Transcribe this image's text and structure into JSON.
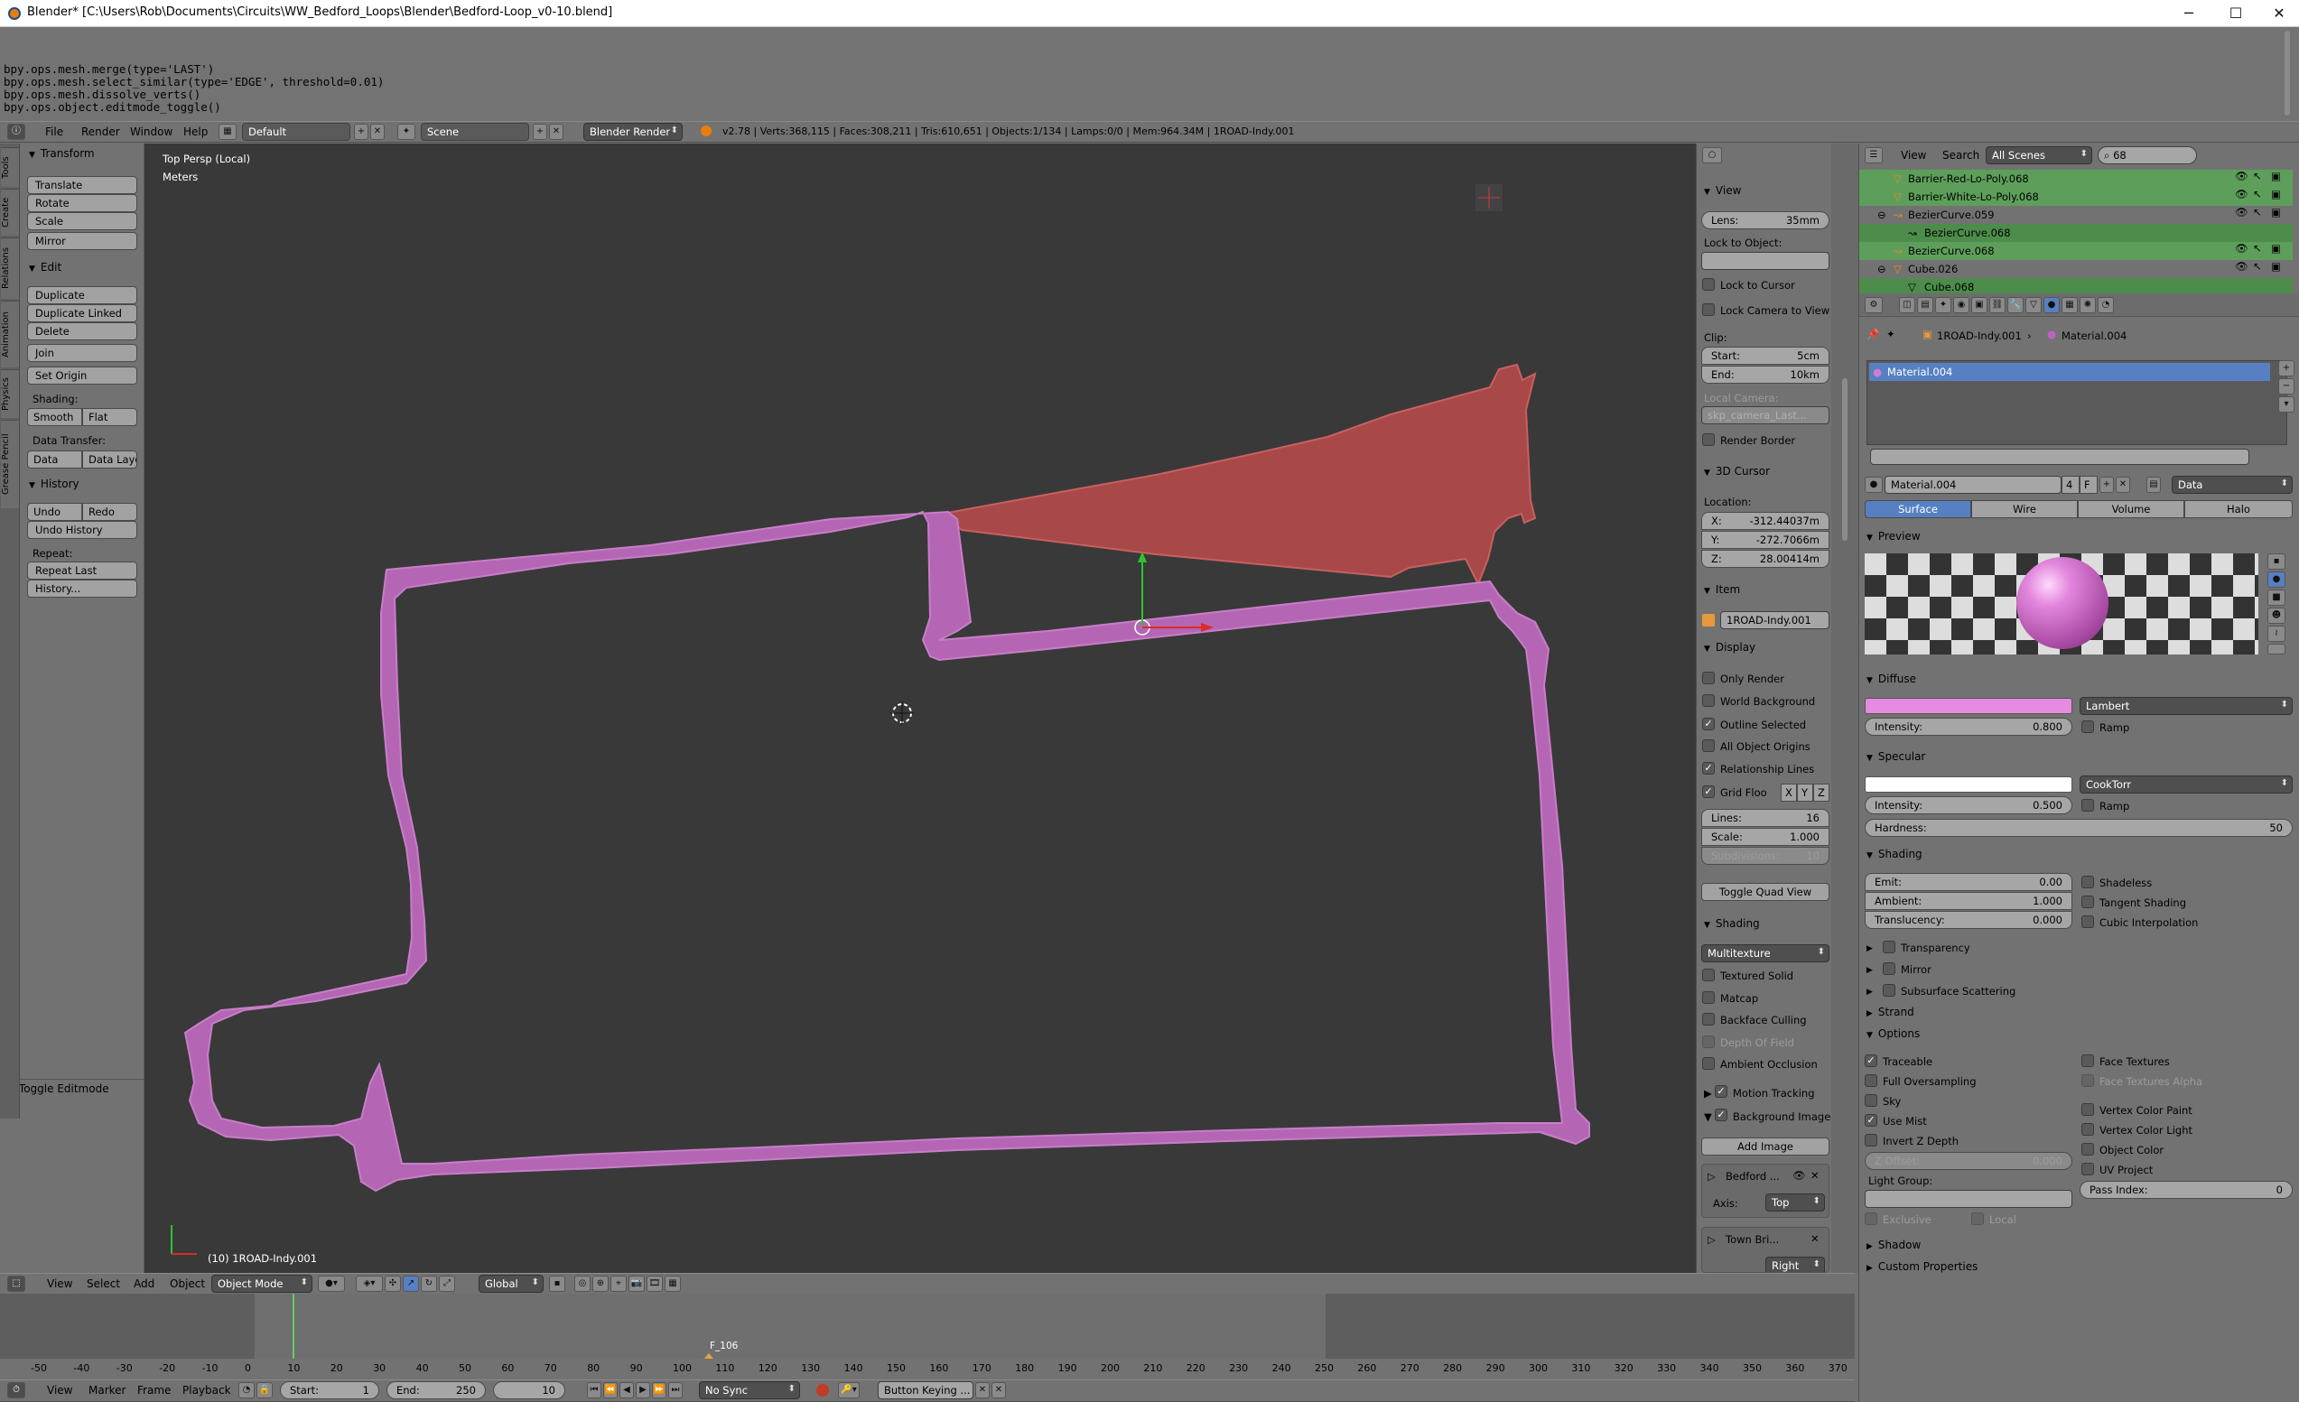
{
  "window": {
    "title": "Blender* [C:\\Users\\Rob\\Documents\\Circuits\\WW_Bedford_Loops\\Blender\\Bedford-Loop_v0-10.blend]",
    "minimize": "─",
    "maximize": "☐",
    "close": "✕"
  },
  "console": {
    "lines": "bpy.ops.mesh.merge(type='LAST')\nbpy.ops.mesh.select_similar(type='EDGE', threshold=0.01)\nbpy.ops.mesh.dissolve_verts()\nbpy.ops.object.editmode_toggle()"
  },
  "info_header": {
    "menus": [
      "File",
      "Render",
      "Window",
      "Help"
    ],
    "layout": "Default",
    "scene": "Scene",
    "engine": "Blender Render",
    "stats": "v2.78 | Verts:368,115 | Faces:308,211 | Tris:610,651 | Objects:1/134 | Lamps:0/0 | Mem:964.34M | 1ROAD-Indy.001"
  },
  "toolshelf": {
    "tabs": [
      "Tools",
      "Create",
      "Relations",
      "Animation",
      "Physics",
      "Grease Pencil"
    ],
    "transform": {
      "title": "Transform",
      "buttons": [
        "Translate",
        "Rotate",
        "Scale",
        "Mirror"
      ]
    },
    "edit": {
      "title": "Edit",
      "buttons": [
        "Duplicate",
        "Duplicate Linked",
        "Delete",
        "Join"
      ],
      "set_origin": "Set Origin",
      "shading_label": "Shading:",
      "smooth": "Smooth",
      "flat": "Flat",
      "data_transfer_label": "Data Transfer:",
      "data": "Data",
      "data_layo": "Data Layo"
    },
    "history": {
      "title": "History",
      "undo": "Undo",
      "redo": "Redo",
      "undo_history": "Undo History",
      "repeat_label": "Repeat:",
      "repeat_last": "Repeat Last",
      "history_btn": "History..."
    },
    "operator": "Toggle Editmode"
  },
  "viewport": {
    "view_name": "Top Persp (Local)",
    "units": "Meters",
    "object_label": "(10) 1ROAD-Indy.001"
  },
  "npanel": {
    "view": {
      "title": "View",
      "lens_label": "Lens:",
      "lens": "35mm",
      "lock_to_object": "Lock to Object:",
      "lock_to_cursor": "Lock to Cursor",
      "lock_camera": "Lock Camera to View",
      "clip": "Clip:",
      "start_label": "Start:",
      "start": "5cm",
      "end_label": "End:",
      "end": "10km",
      "local_camera": "Local Camera:",
      "local_camera_value": "skp_camera_Last...",
      "render_border": "Render Border"
    },
    "cursor": {
      "title": "3D Cursor",
      "location": "Location:",
      "x_label": "X:",
      "x": "-312.44037m",
      "y_label": "Y:",
      "y": "-272.7066m",
      "z_label": "Z:",
      "z": "28.00414m"
    },
    "item": {
      "title": "Item",
      "name": "1ROAD-Indy.001"
    },
    "display": {
      "title": "Display",
      "only_render": "Only Render",
      "world_background": "World Background",
      "outline_selected": "Outline Selected",
      "all_object_origins": "All Object Origins",
      "relationship_lines": "Relationship Lines",
      "grid_floor": "Grid Floo",
      "x": "X",
      "y": "Y",
      "z": "Z",
      "lines_label": "Lines:",
      "lines": "16",
      "scale_label": "Scale:",
      "scale": "1.000",
      "subdivisions_label": "Subdivisions:",
      "subdivisions": "10",
      "toggle_quad": "Toggle Quad View"
    },
    "shading": {
      "title": "Shading",
      "mode": "Multitexture",
      "textured_solid": "Textured Solid",
      "matcap": "Matcap",
      "backface_culling": "Backface Culling",
      "depth_of_field": "Depth Of Field",
      "ambient_occlusion": "Ambient Occlusion"
    },
    "motion_tracking": "Motion Tracking",
    "background_images": "Background Images",
    "add_image": "Add Image",
    "bg1": {
      "name": "Bedford ...",
      "axis_label": "Axis:",
      "axis": "Top"
    },
    "bg2": {
      "name": "Town Bri...",
      "axis": "Right"
    }
  },
  "outliner": {
    "view": "View",
    "search": "Search",
    "scenes": "All Scenes",
    "filter": "68",
    "rows": [
      "Barrier-Red-Lo-Poly.068",
      "Barrier-White-Lo-Poly.068",
      "BezierCurve.059",
      "BezierCurve.068",
      "BezierCurve.068",
      "Cube.026",
      "Cube.068"
    ]
  },
  "properties": {
    "breadcrumb_obj": "1ROAD-Indy.001",
    "breadcrumb_mat": "Material.004",
    "slot": "Material.004",
    "mat_name": "Material.004",
    "users": "4",
    "f": "F",
    "data_link": "Data",
    "tabs": [
      "Surface",
      "Wire",
      "Volume",
      "Halo"
    ],
    "preview": "Preview",
    "diffuse": {
      "title": "Diffuse",
      "shader": "Lambert",
      "intensity_label": "Intensity:",
      "intensity": "0.800",
      "ramp": "Ramp",
      "color": "#e58be0"
    },
    "specular": {
      "title": "Specular",
      "shader": "CookTorr",
      "intensity_label": "Intensity:",
      "intensity": "0.500",
      "ramp": "Ramp",
      "hardness_label": "Hardness:",
      "hardness": "50"
    },
    "shading": {
      "title": "Shading",
      "emit_label": "Emit:",
      "emit": "0.00",
      "ambient_label": "Ambient:",
      "ambient": "1.000",
      "translucency_label": "Translucency:",
      "translucency": "0.000",
      "shadeless": "Shadeless",
      "tangent": "Tangent Shading",
      "cubic": "Cubic Interpolation"
    },
    "transparency": "Transparency",
    "mirror": "Mirror",
    "sss": "Subsurface Scattering",
    "strand": "Strand",
    "options": {
      "title": "Options",
      "traceable": "Traceable",
      "full_oversampling": "Full Oversampling",
      "sky": "Sky",
      "use_mist": "Use Mist",
      "invert_z": "Invert Z Depth",
      "z_offset_label": "Z Offset:",
      "z_offset": "0.000",
      "light_group": "Light Group:",
      "exclusive": "Exclusive",
      "local": "Local",
      "face_textures": "Face Textures",
      "face_textures_alpha": "Face Textures Alpha",
      "vertex_color_paint": "Vertex Color Paint",
      "vertex_color_light": "Vertex Color Light",
      "object_color": "Object Color",
      "uv_project": "UV Project",
      "pass_index_label": "Pass Index:",
      "pass_index": "0"
    },
    "shadow": "Shadow",
    "custom_props": "Custom Properties"
  },
  "view3d_header": {
    "menus": [
      "View",
      "Select",
      "Add",
      "Object"
    ],
    "mode": "Object Mode",
    "orientation": "Global"
  },
  "timeline": {
    "ticks": [
      "-50",
      "-40",
      "-30",
      "-20",
      "-10",
      "0",
      "10",
      "20",
      "30",
      "40",
      "50",
      "60",
      "70",
      "80",
      "90",
      "100",
      "110",
      "120",
      "130",
      "140",
      "150",
      "160",
      "170",
      "180",
      "190",
      "200",
      "210",
      "220",
      "230",
      "240",
      "250",
      "260",
      "270",
      "280",
      "290",
      "300",
      "310",
      "320",
      "330",
      "340",
      "350",
      "360",
      "370"
    ],
    "marker": "F_106",
    "current_frame": 10
  },
  "timeline_header": {
    "menus": [
      "View",
      "Marker",
      "Frame",
      "Playback"
    ],
    "start_label": "Start:",
    "start": "1",
    "end_label": "End:",
    "end": "250",
    "frame": "10",
    "sync": "No Sync",
    "keying": "Button Keying ..."
  },
  "colors": {
    "track_selected": "#b466b4",
    "track_red": "#a84848",
    "viewport_bg": "#393939",
    "selection_blue": "#5680c2"
  }
}
